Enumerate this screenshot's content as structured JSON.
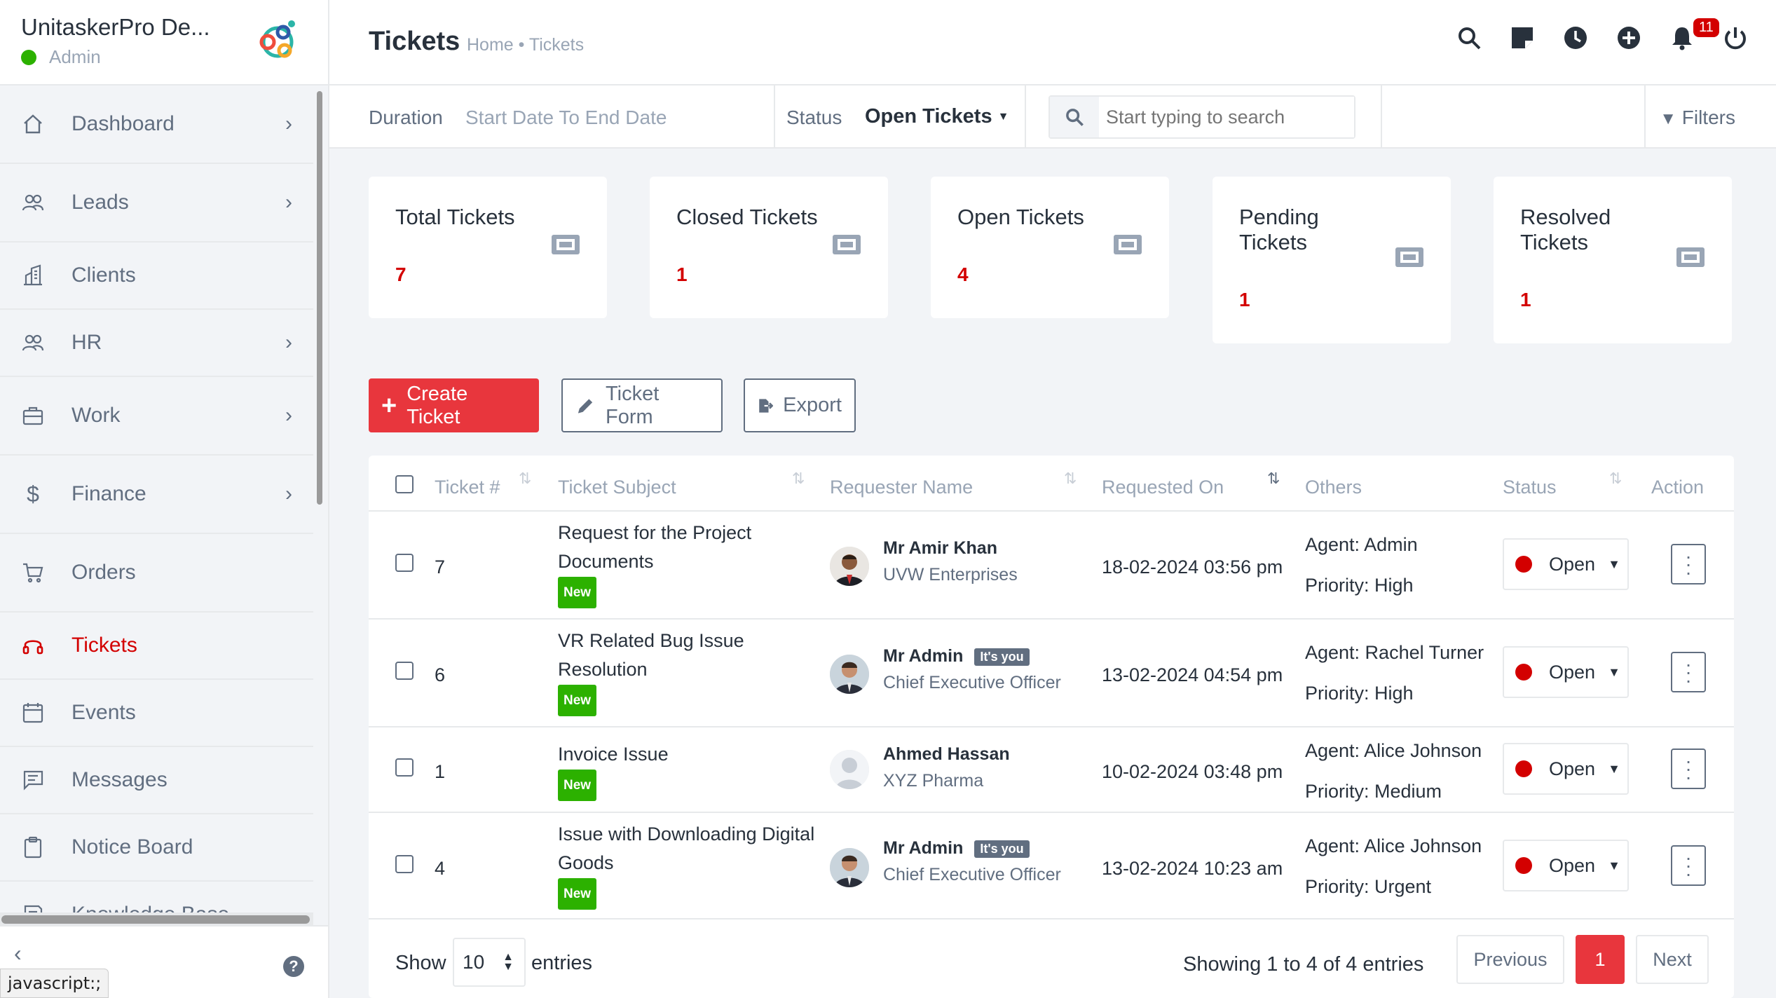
{
  "sidebar": {
    "company": "UnitaskerPro De...",
    "role": "Admin",
    "items": [
      {
        "label": "Dashboard",
        "has_chevron": true
      },
      {
        "label": "Leads",
        "has_chevron": true
      },
      {
        "label": "Clients",
        "has_chevron": false
      },
      {
        "label": "HR",
        "has_chevron": true
      },
      {
        "label": "Work",
        "has_chevron": true
      },
      {
        "label": "Finance",
        "has_chevron": true
      },
      {
        "label": "Orders",
        "has_chevron": false
      },
      {
        "label": "Tickets",
        "has_chevron": false,
        "active": true
      },
      {
        "label": "Events",
        "has_chevron": false
      },
      {
        "label": "Messages",
        "has_chevron": false
      },
      {
        "label": "Notice Board",
        "has_chevron": false
      },
      {
        "label": "Knowledge Base",
        "has_chevron": false
      }
    ],
    "status_tooltip": "javascript:;"
  },
  "header": {
    "title": "Tickets",
    "breadcrumb": "Home • Tickets",
    "notification_count": "11"
  },
  "filters": {
    "duration_label": "Duration",
    "duration_value": "Start Date To End Date",
    "status_label": "Status",
    "status_value": "Open Tickets",
    "search_placeholder": "Start typing to search",
    "filters_label": "Filters"
  },
  "cards": [
    {
      "title": "Total Tickets",
      "value": "7"
    },
    {
      "title": "Closed Tickets",
      "value": "1"
    },
    {
      "title": "Open Tickets",
      "value": "4"
    },
    {
      "title": "Pending Tickets",
      "value": "1"
    },
    {
      "title": "Resolved Tickets",
      "value": "1"
    }
  ],
  "actions": {
    "create": "Create Ticket",
    "form": "Ticket Form",
    "export": "Export"
  },
  "table": {
    "headers": [
      "Ticket #",
      "Ticket Subject",
      "Requester Name",
      "Requested On",
      "Others",
      "Status",
      "Action"
    ],
    "rows": [
      {
        "id": "7",
        "subject": "Request for the Project Documents",
        "badge": "New",
        "requester": "Mr Amir Khan",
        "requester_sub": "UVW Enterprises",
        "you": "",
        "date": "18-02-2024 03:56 pm",
        "agent": "Agent: Admin",
        "priority": "Priority: High",
        "status": "Open"
      },
      {
        "id": "6",
        "subject": "VR Related Bug Issue Resolution",
        "badge": "New",
        "requester": "Mr Admin",
        "requester_sub": "Chief Executive Officer",
        "you": "It's you",
        "date": "13-02-2024 04:54 pm",
        "agent": "Agent: Rachel Turner",
        "priority": "Priority: High",
        "status": "Open"
      },
      {
        "id": "1",
        "subject": "Invoice Issue",
        "badge": "New",
        "requester": "Ahmed Hassan",
        "requester_sub": "XYZ Pharma",
        "you": "",
        "date": "10-02-2024 03:48 pm",
        "agent": "Agent: Alice Johnson",
        "priority": "Priority: Medium",
        "status": "Open"
      },
      {
        "id": "4",
        "subject": "Issue with Downloading Digital Goods",
        "badge": "New",
        "requester": "Mr Admin",
        "requester_sub": "Chief Executive Officer",
        "you": "It's you",
        "date": "13-02-2024 10:23 am",
        "agent": "Agent: Alice Johnson",
        "priority": "Priority: Urgent",
        "status": "Open"
      }
    ]
  },
  "footer": {
    "show": "Show",
    "page_size": "10",
    "entries": "entries",
    "summary": "Showing 1 to 4 of 4 entries",
    "prev": "Previous",
    "page": "1",
    "next": "Next"
  },
  "colors": {
    "accent": "#d30000",
    "primary_button": "#e8363d",
    "new_badge": "#2cb100"
  }
}
